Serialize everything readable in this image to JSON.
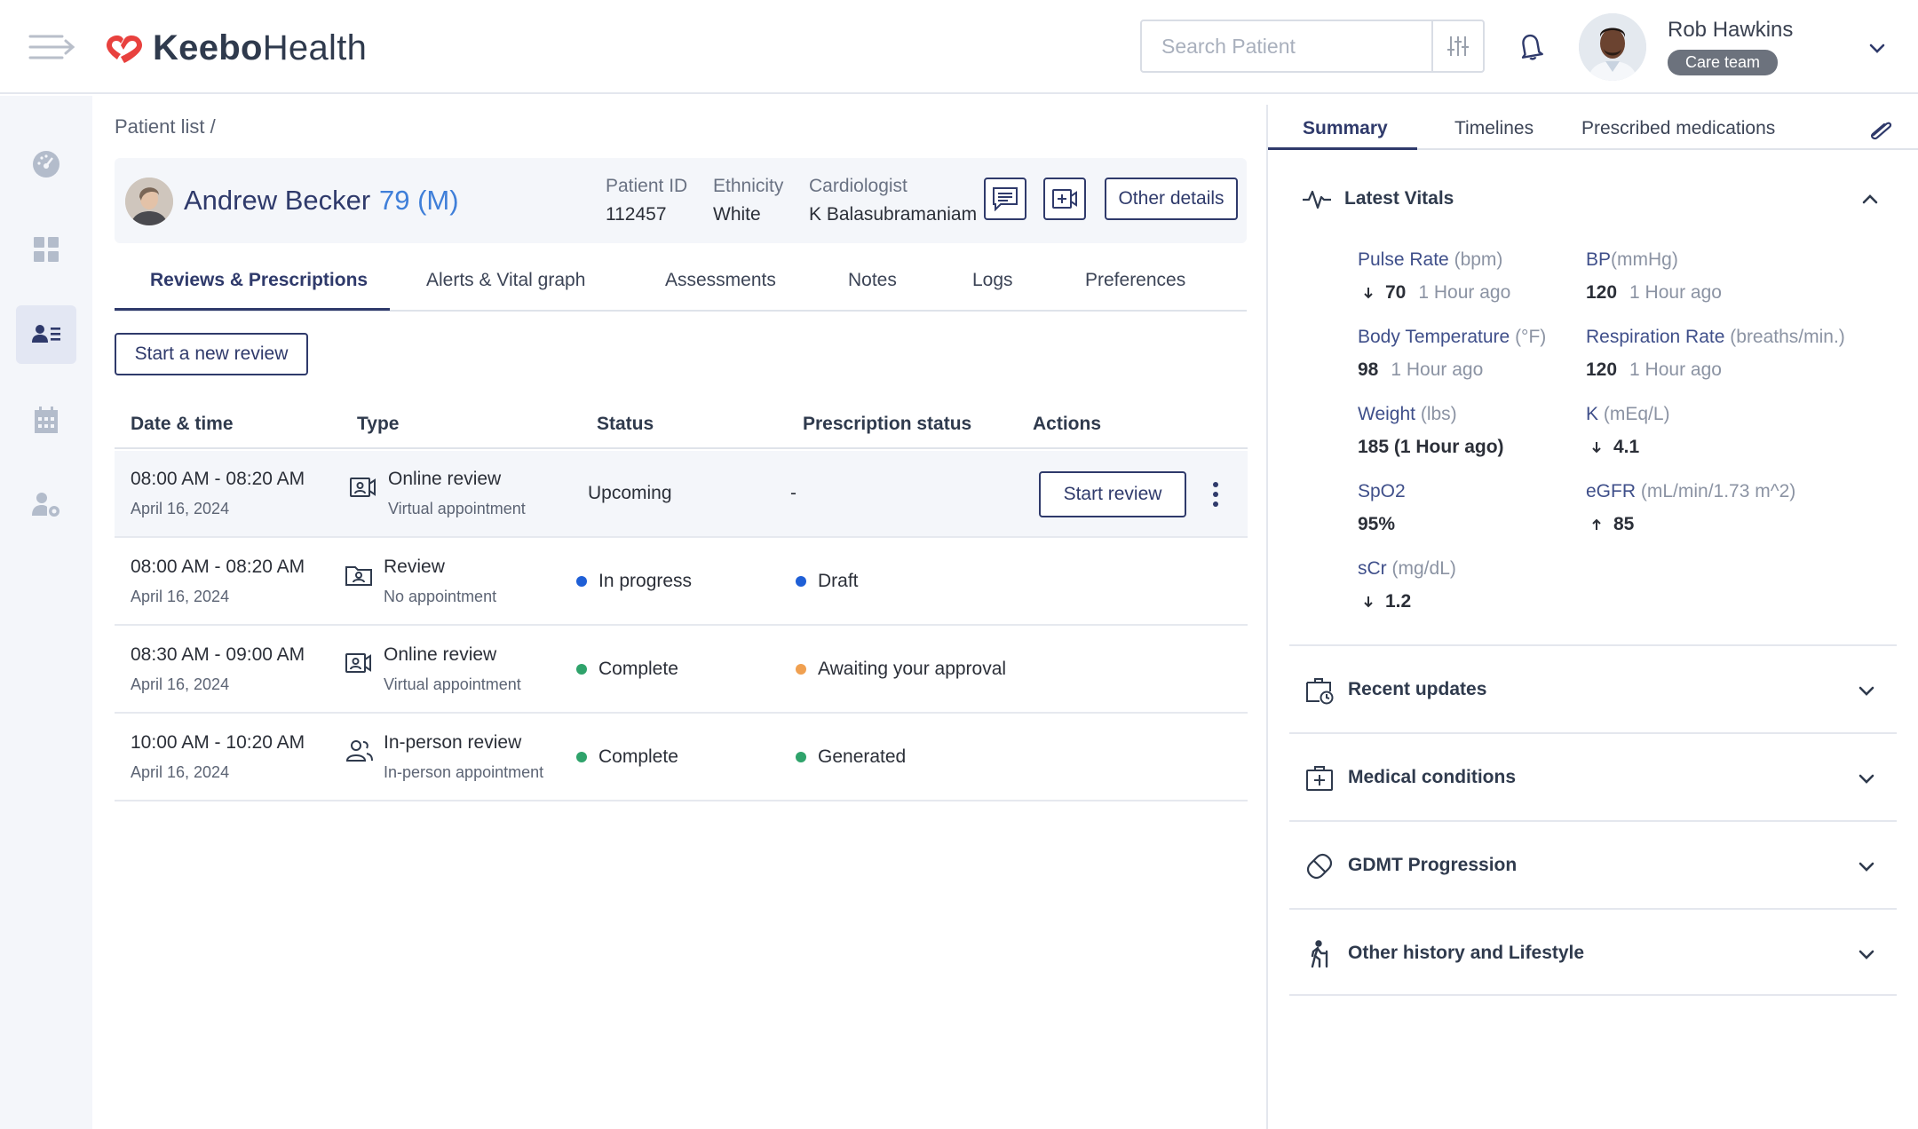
{
  "app": {
    "brand_bold": "Keebo",
    "brand_light": "Health",
    "colors": {
      "primary": "#2f3a6b",
      "accent": "#3f7fd9",
      "logo_red": "#e8413e"
    }
  },
  "header": {
    "search_placeholder": "Search Patient",
    "user_name": "Rob Hawkins",
    "user_role": "Care team",
    "icons": [
      "menu-icon",
      "filter-sliders-icon",
      "bell-icon",
      "chevron-down-icon"
    ]
  },
  "rail": {
    "items": [
      "dashboard-gauge-icon",
      "grid-icon",
      "patient-list-icon",
      "calendar-icon",
      "user-settings-icon"
    ],
    "active": "patient-list-icon"
  },
  "breadcrumb": "Patient list /",
  "patient": {
    "name": "Andrew Becker",
    "age_sex": "79 (M)",
    "id_label": "Patient ID",
    "id_value": "112457",
    "ethnicity_label": "Ethnicity",
    "ethnicity_value": "White",
    "cardiologist_label": "Cardiologist",
    "cardiologist_value": "K Balasubramaniam",
    "other_details": "Other details"
  },
  "tabs": [
    {
      "label": "Reviews & Prescriptions",
      "active": true
    },
    {
      "label": "Alerts & Vital graph"
    },
    {
      "label": "Assessments"
    },
    {
      "label": "Notes"
    },
    {
      "label": "Logs"
    },
    {
      "label": "Preferences"
    }
  ],
  "new_review_label": "Start a new review",
  "table": {
    "headers": [
      "Date & time",
      "Type",
      "Status",
      "Prescription status",
      "Actions"
    ],
    "rows": [
      {
        "time": "08:00 AM - 08:20 AM",
        "date": "April 16, 2024",
        "type": "Online review",
        "type_sub": "Virtual appointment",
        "type_icon": "video-contact-icon",
        "status": "Upcoming",
        "status_color": "",
        "rx": "-",
        "rx_color": "",
        "action": "Start review"
      },
      {
        "time": "08:00 AM - 08:20 AM",
        "date": "April 16, 2024",
        "type": "Review",
        "type_sub": "No appointment",
        "type_icon": "folder-user-icon",
        "status": "In progress",
        "status_color": "#1f5fd6",
        "rx": "Draft",
        "rx_color": "#1f5fd6",
        "action": ""
      },
      {
        "time": "08:30 AM - 09:00 AM",
        "date": "April 16, 2024",
        "type": "Online review",
        "type_sub": "Virtual appointment",
        "type_icon": "video-contact-icon",
        "status": "Complete",
        "status_color": "#2fa36b",
        "rx": "Awaiting your approval",
        "rx_color": "#f0a050",
        "action": ""
      },
      {
        "time": "10:00 AM - 10:20 AM",
        "date": "April 16, 2024",
        "type": "In-person review",
        "type_sub": "In-person appointment",
        "type_icon": "people-icon",
        "status": "Complete",
        "status_color": "#2fa36b",
        "rx": "Generated",
        "rx_color": "#2fa36b",
        "action": ""
      }
    ]
  },
  "right_panel": {
    "tabs": [
      {
        "label": "Summary",
        "active": true
      },
      {
        "label": "Timelines"
      },
      {
        "label": "Prescribed medications"
      }
    ],
    "vitals_title": "Latest Vitals",
    "vitals": {
      "pulse": {
        "label": "Pulse Rate",
        "unit": "(bpm)",
        "value": "70",
        "ago": "1 Hour ago",
        "trend": "down"
      },
      "bp": {
        "label": "BP",
        "unit": "(mmHg)",
        "value": "120",
        "ago": "1 Hour ago"
      },
      "temp": {
        "label": "Body Temperature",
        "unit": "(°F)",
        "value": "98",
        "ago": "1 Hour ago"
      },
      "resp": {
        "label": "Respiration Rate",
        "unit": "(breaths/min.)",
        "value": "120",
        "ago": "1 Hour ago"
      },
      "weight": {
        "label": "Weight",
        "unit": "(lbs)",
        "value": "185 (1 Hour ago)"
      },
      "k": {
        "label": "K",
        "unit": "(mEq/L)",
        "value": "4.1",
        "trend": "down"
      },
      "spo2": {
        "label": "SpO2",
        "unit": "",
        "value": "95%"
      },
      "egfr": {
        "label": "eGFR",
        "unit": "(mL/min/1.73 m^2)",
        "value": "85",
        "trend": "up"
      },
      "scr": {
        "label": "sCr",
        "unit": "(mg/dL)",
        "value": "1.2",
        "trend": "down"
      }
    },
    "sections": [
      {
        "label": "Recent updates",
        "icon": "briefcase-clock-icon"
      },
      {
        "label": "Medical conditions",
        "icon": "medical-kit-icon"
      },
      {
        "label": "GDMT Progression",
        "icon": "pill-icon"
      },
      {
        "label": "Other history and Lifestyle",
        "icon": "walking-person-icon"
      }
    ]
  }
}
